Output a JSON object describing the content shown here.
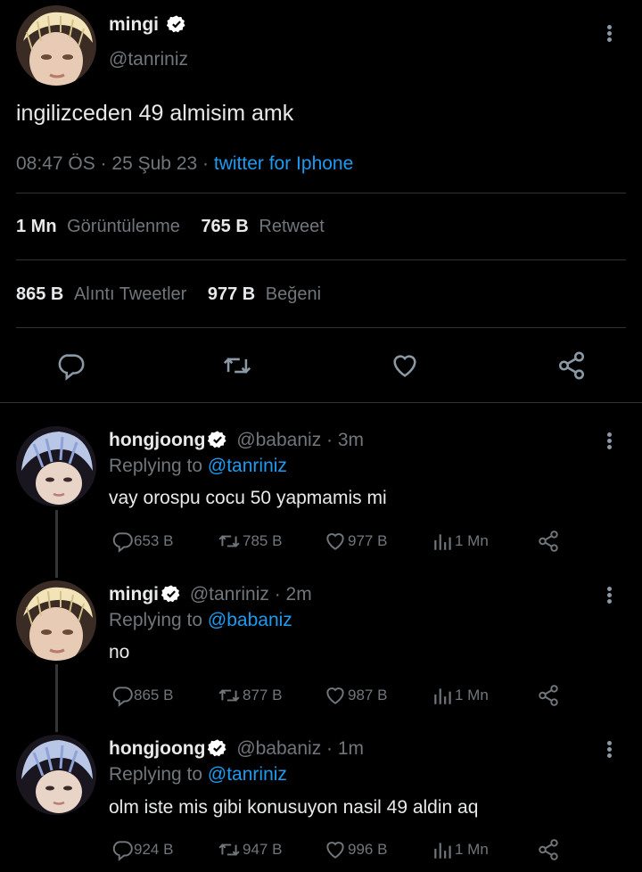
{
  "colors": {
    "background": "#000000",
    "text": "#e7e9ea",
    "muted": "#71767b",
    "accent": "#1d9bf0",
    "divider": "#2f3336"
  },
  "main_tweet": {
    "author_name": "mingi",
    "author_handle": "@tanriniz",
    "text": "ingilizceden 49 almisim amk",
    "time": "08:47 ÖS",
    "date": "25 Şub 23",
    "sep1": "·",
    "sep2": "·",
    "source": "twitter for Iphone",
    "stats": {
      "views_value": "1 Mn",
      "views_label": "Görüntülenme",
      "retweets_value": "765 B",
      "retweets_label": "Retweet",
      "quotes_value": "865 B",
      "quotes_label": "Alıntı Tweetler",
      "likes_value": "977 B",
      "likes_label": "Beğeni"
    },
    "actions": [
      "reply-icon",
      "retweet-icon",
      "like-icon",
      "share-icon"
    ]
  },
  "replies": [
    {
      "author_name": "hongjoong",
      "author_handle": "@babaniz",
      "time_ago": "· 3m",
      "replying_label": "Replying to",
      "replying_to": "@tanriniz",
      "text": "vay orospu cocu 50 yapmamis mi",
      "replies": "653 B",
      "retweets": "785 B",
      "likes": "977 B",
      "views": "1 Mn"
    },
    {
      "author_name": "mingi",
      "author_handle": "@tanriniz",
      "time_ago": "· 2m",
      "replying_label": "Replying to",
      "replying_to": "@babaniz",
      "text": "no",
      "replies": "865 B",
      "retweets": "877 B",
      "likes": "987 B",
      "views": "1 Mn"
    },
    {
      "author_name": "hongjoong",
      "author_handle": "@babaniz",
      "time_ago": "· 1m",
      "replying_label": "Replying to",
      "replying_to": "@tanriniz",
      "text": "olm iste mis gibi konusuyon nasil 49 aldin aq",
      "replies": "924 B",
      "retweets": "947 B",
      "likes": "996 B",
      "views": "1 Mn"
    }
  ]
}
